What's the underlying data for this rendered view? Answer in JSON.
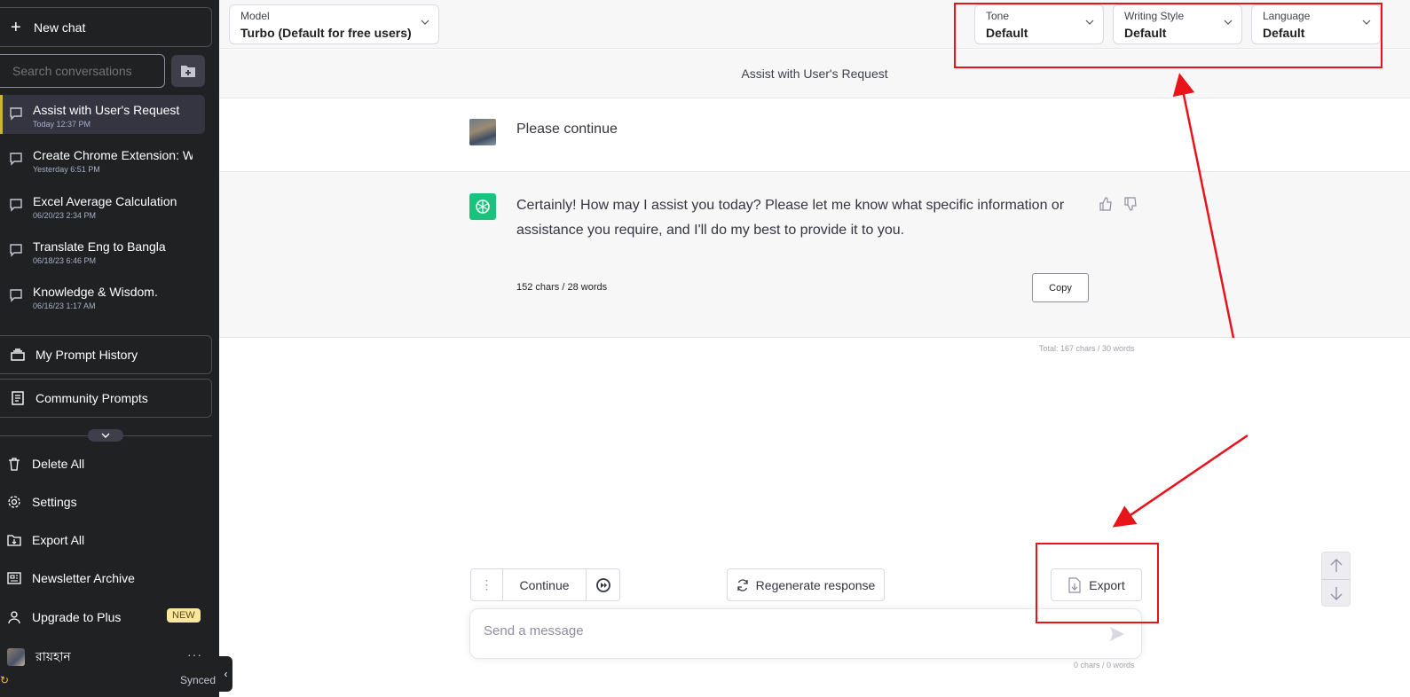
{
  "sidebar": {
    "new_chat": "New chat",
    "search_placeholder": "Search conversations",
    "conversations": [
      {
        "title": "Assist with User's Request",
        "date": "Today 12:37 PM"
      },
      {
        "title": "Create Chrome Extension: W",
        "date": "Yesterday 6:51 PM"
      },
      {
        "title": "Excel Average Calculation",
        "date": "06/20/23 2:34 PM"
      },
      {
        "title": "Translate Eng to Bangla",
        "date": "06/18/23 6:46 PM"
      },
      {
        "title": "Knowledge & Wisdom.",
        "date": "06/16/23 1:17 AM"
      }
    ],
    "prompt_history": "My Prompt History",
    "community_prompts": "Community Prompts",
    "menu": {
      "delete_all": "Delete All",
      "settings": "Settings",
      "export_all": "Export All",
      "newsletter": "Newsletter Archive",
      "upgrade": "Upgrade to Plus",
      "new_badge": "NEW"
    },
    "user_name": "রায়হান",
    "synced": "Synced"
  },
  "topbar": {
    "model": {
      "label": "Model",
      "value": "Turbo (Default for free users)"
    },
    "tone": {
      "label": "Tone",
      "value": "Default"
    },
    "writing_style": {
      "label": "Writing Style",
      "value": "Default"
    },
    "language": {
      "label": "Language",
      "value": "Default"
    }
  },
  "conversation": {
    "title": "Assist with User's Request",
    "user_message": "Please continue",
    "bot_message_line1": "Certainly! How may I assist you today? Please let me know what specific information or",
    "bot_message_line2": "assistance you require, and I'll do my best to provide it to you.",
    "bot_count": "152 chars / 28 words",
    "copy_label": "Copy",
    "total_count": "Total: 167 chars / 30 words"
  },
  "controls": {
    "continue": "Continue",
    "regenerate": "Regenerate response",
    "export": "Export",
    "input_placeholder": "Send a message",
    "input_count": "0 chars / 0 words"
  },
  "colors": {
    "sidebar_bg": "#202123",
    "accent_green": "#19c37d",
    "annotation_red": "#e8141a",
    "badge_bg": "#fae69e"
  }
}
